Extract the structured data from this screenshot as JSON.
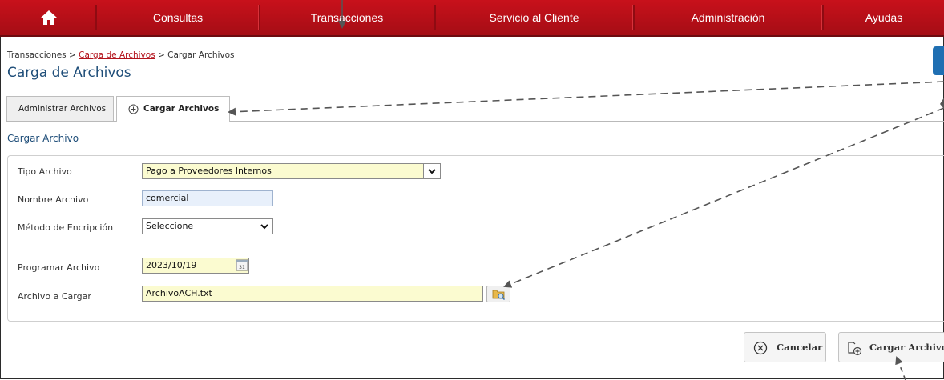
{
  "nav": {
    "items": [
      "Consultas",
      "Transacciones",
      "Servicio al Cliente",
      "Administración",
      "Ayudas"
    ]
  },
  "breadcrumb": {
    "part1": "Transacciones",
    "sep": " > ",
    "part2": "Carga de Archivos",
    "part3": "Cargar Archivos"
  },
  "page_title": "Carga de Archivos",
  "tabs": {
    "tab1": "Administrar Archivos",
    "tab2": "Cargar Archivos"
  },
  "section_title": "Cargar Archivo",
  "form": {
    "tipo_label": "Tipo Archivo",
    "tipo_value": "Pago a Proveedores Internos",
    "nombre_label": "Nombre Archivo",
    "nombre_value": "comercial",
    "metodo_label": "Método de Encripción",
    "metodo_value": "Seleccione",
    "programar_label": "Programar Archivo",
    "programar_value": "2023/10/19",
    "archivo_label": "Archivo a Cargar",
    "archivo_value": "ArchivoACH.txt"
  },
  "buttons": {
    "cancel": "Cancelar",
    "upload": "Cargar Archivo"
  },
  "colors": {
    "nav_red": "#b00f18",
    "title_blue": "#1f4e79",
    "field_yellow": "#fbfbd0"
  }
}
